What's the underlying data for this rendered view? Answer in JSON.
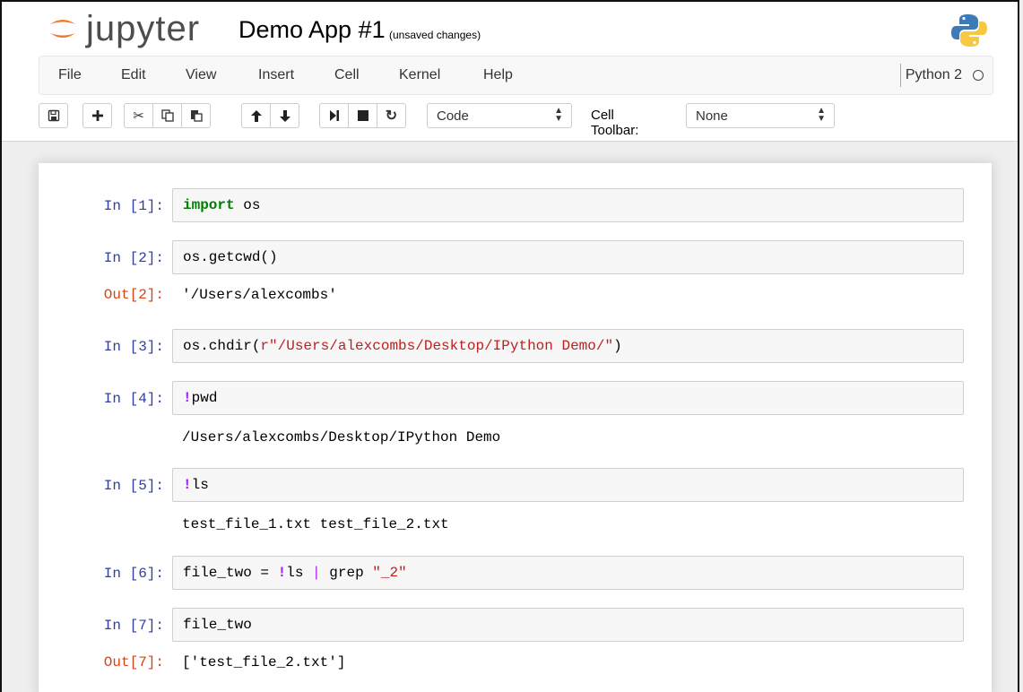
{
  "header": {
    "logo_text": "jupyter",
    "notebook_name": "Demo App #1",
    "save_status": "(unsaved changes)"
  },
  "menu": {
    "items": [
      "File",
      "Edit",
      "View",
      "Insert",
      "Cell",
      "Kernel",
      "Help"
    ],
    "kernel_name": "Python 2"
  },
  "toolbar": {
    "cell_type": "Code",
    "cell_toolbar_label": "Cell Toolbar:",
    "cell_toolbar_value": "None"
  },
  "cells": [
    {
      "prompt": "In [1]:",
      "code": "import os"
    },
    {
      "prompt": "In [2]:",
      "code": "os.getcwd()",
      "out_prompt": "Out[2]:",
      "output": "'/Users/alexcombs'"
    },
    {
      "prompt": "In [3]:",
      "code": "os.chdir(r\"/Users/alexcombs/Desktop/IPython Demo/\")"
    },
    {
      "prompt": "In [4]:",
      "code": "!pwd",
      "output": "/Users/alexcombs/Desktop/IPython Demo"
    },
    {
      "prompt": "In [5]:",
      "code": "!ls",
      "output": "test_file_1.txt test_file_2.txt"
    },
    {
      "prompt": "In [6]:",
      "code": "file_two = !ls | grep \"_2\""
    },
    {
      "prompt": "In [7]:",
      "code": "file_two",
      "out_prompt": "Out[7]:",
      "output": "['test_file_2.txt']"
    }
  ],
  "code_parts": {
    "c1_kw": "import",
    "c1_rest": " os",
    "c3_a": "os.chdir(",
    "c3_str": "r\"/Users/alexcombs/Desktop/IPython Demo/\"",
    "c3_b": ")",
    "c4_bang": "!",
    "c4_rest": "pwd",
    "c5_bang": "!",
    "c5_rest": "ls",
    "c6_a": "file_two = ",
    "c6_bang": "!",
    "c6_b": "ls ",
    "c6_pipe": "|",
    "c6_c": " grep ",
    "c6_str": "\"_2\""
  }
}
